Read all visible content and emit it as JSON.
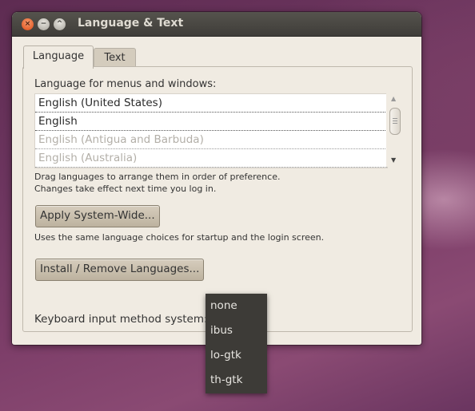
{
  "window": {
    "title": "Language & Text",
    "controls": {
      "close": "×",
      "minimize": "−",
      "maximize": "^"
    }
  },
  "tabs": [
    {
      "label": "Language",
      "active": true
    },
    {
      "label": "Text",
      "active": false
    }
  ],
  "language": {
    "section_label": "Language for menus and windows:",
    "items": [
      {
        "label": "English (United States)",
        "enabled": true
      },
      {
        "label": "English",
        "enabled": true
      },
      {
        "label": "English (Antigua and Barbuda)",
        "enabled": false
      },
      {
        "label": "English (Australia)",
        "enabled": false
      }
    ],
    "hint_line1": "Drag languages to arrange them in order of preference.",
    "hint_line2": "Changes take effect next time you log in.",
    "apply_button": "Apply System-Wide...",
    "apply_hint": "Uses the same language choices for startup and the login screen.",
    "install_button": "Install / Remove Languages...",
    "keyboard_label": "Keyboard input method system:"
  },
  "input_method_menu": {
    "options": [
      "none",
      "ibus",
      "lo-gtk",
      "th-gtk"
    ]
  },
  "colors": {
    "titlebar": "#3f3d39",
    "window_bg": "#f0ebe2",
    "close_button": "#df4b16",
    "menu_bg": "#3d3b37"
  }
}
